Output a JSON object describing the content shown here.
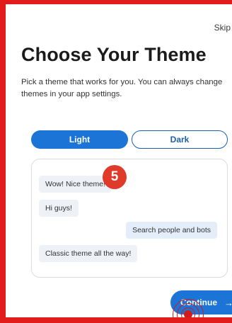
{
  "header": {
    "skip_label": "Skip",
    "title": "Choose Your Theme",
    "subtitle": "Pick a theme that works for you. You can always change themes in your app settings."
  },
  "theme_toggle": {
    "options": [
      {
        "label": "Light",
        "selected": true
      },
      {
        "label": "Dark",
        "selected": false
      }
    ]
  },
  "preview": {
    "messages": [
      {
        "text": "Wow! Nice theme!"
      },
      {
        "text": "Hi guys!"
      },
      {
        "text": "Search people and bots"
      },
      {
        "text": "Classic theme all the way!"
      }
    ]
  },
  "annotation": {
    "step_number": "5"
  },
  "footer": {
    "continue_label": "Continue",
    "continue_arrow": "→"
  },
  "colors": {
    "accent": "#1b74d6",
    "frame": "#e21b1b",
    "badge": "#e03a2a"
  }
}
